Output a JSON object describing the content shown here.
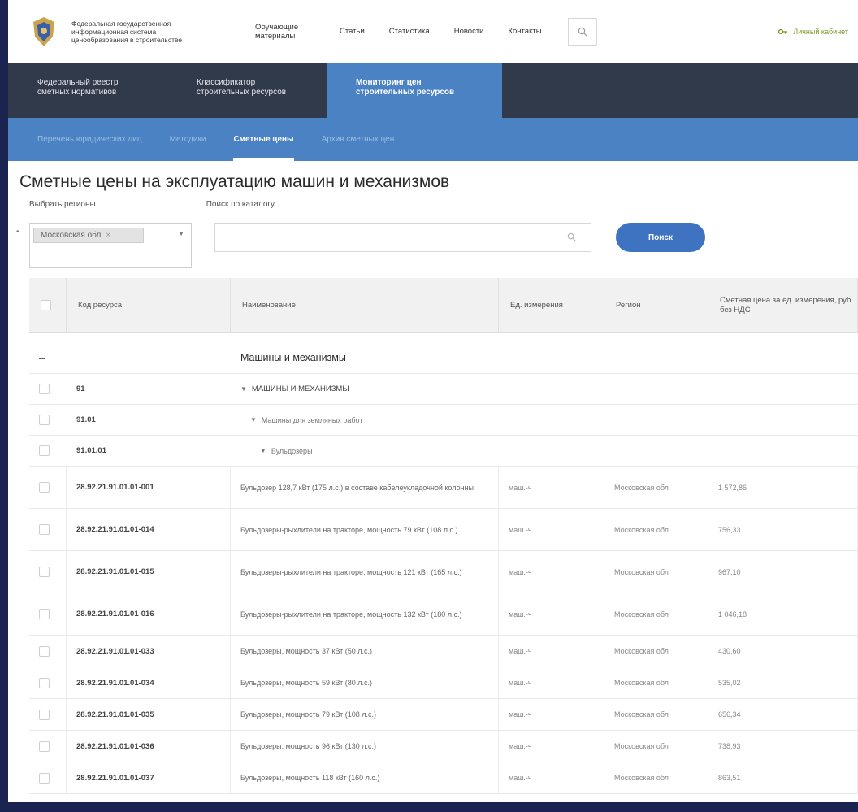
{
  "header": {
    "org_name_lines": [
      "Федеральная государственная",
      "информационная система",
      "ценообразования в строительстве"
    ],
    "nav": [
      {
        "label": "Обучающие материалы"
      },
      {
        "label": "Статьи"
      },
      {
        "label": "Статистика"
      },
      {
        "label": "Новости"
      },
      {
        "label": "Контакты"
      }
    ],
    "cabinet_label": "Личный кабинет"
  },
  "main_tabs": [
    {
      "line1": "Федеральный реестр",
      "line2": "сметных нормативов"
    },
    {
      "line1": "Классификатор",
      "line2": "строительных ресурсов"
    },
    {
      "line1": "Мониторинг цен",
      "line2": "строительных ресурсов"
    }
  ],
  "sub_tabs": [
    {
      "label": "Перечень юридических лиц"
    },
    {
      "label": "Методики"
    },
    {
      "label": "Сметные цены"
    },
    {
      "label": "Архив сметных цен"
    }
  ],
  "page": {
    "title": "Сметные цены на эксплуатацию машин и механизмов",
    "regions_label": "Выбрать регионы",
    "catalog_label": "Поиск по каталогу",
    "selected_region": "Московская обл",
    "search_value": "",
    "search_button": "Поиск"
  },
  "table": {
    "columns": [
      "Код ресурса",
      "Наименование",
      "Ед. измерения",
      "Регион",
      "Сметная цена за ед. измерения, руб. без НДС"
    ],
    "group_title": "Машины и механизмы",
    "levels": [
      {
        "code": "91",
        "name": "МАШИНЫ И МЕХАНИЗМЫ"
      },
      {
        "code": "91.01",
        "name": "Машины для земляных работ"
      },
      {
        "code": "91.01.01",
        "name": "Бульдозеры"
      }
    ],
    "rows": [
      {
        "code": "28.92.21.91.01.01-001",
        "name": "Бульдозер 128,7 кВт (175 л.с.) в составе кабелеукладочной колонны",
        "unit": "маш.-ч",
        "region": "Московская обл",
        "price": "1 572,86"
      },
      {
        "code": "28.92.21.91.01.01-014",
        "name": "Бульдозеры-рыхлители на тракторе, мощность 79 кВт (108 л.с.)",
        "unit": "маш.-ч",
        "region": "Московская обл",
        "price": "756,33"
      },
      {
        "code": "28.92.21.91.01.01-015",
        "name": "Бульдозеры-рыхлители на тракторе, мощность 121 кВт (165 л.с.)",
        "unit": "маш.-ч",
        "region": "Московская обл",
        "price": "967,10"
      },
      {
        "code": "28.92.21.91.01.01-016",
        "name": "Бульдозеры-рыхлители на тракторе, мощность 132 кВт (180 л.с.)",
        "unit": "маш.-ч",
        "region": "Московская обл",
        "price": "1 046,18"
      },
      {
        "code": "28.92.21.91.01.01-033",
        "name": "Бульдозеры, мощность 37 кВт (50 л.с.)",
        "unit": "маш.-ч",
        "region": "Московская обл",
        "price": "430,60"
      },
      {
        "code": "28.92.21.91.01.01-034",
        "name": "Бульдозеры, мощность 59 кВт (80 л.с.)",
        "unit": "маш.-ч",
        "region": "Московская обл",
        "price": "535,02"
      },
      {
        "code": "28.92.21.91.01.01-035",
        "name": "Бульдозеры, мощность 79 кВт (108 л.с.)",
        "unit": "маш.-ч",
        "region": "Московская обл",
        "price": "656,34"
      },
      {
        "code": "28.92.21.91.01.01-036",
        "name": "Бульдозеры, мощность 96 кВт (130 л.с.)",
        "unit": "маш.-ч",
        "region": "Московская обл",
        "price": "738,93"
      },
      {
        "code": "28.92.21.91.01.01-037",
        "name": "Бульдозеры, мощность 118 кВт (160 л.с.)",
        "unit": "маш.-ч",
        "region": "Московская обл",
        "price": "863,51"
      }
    ]
  },
  "colors": {
    "dark_tabs": "#313a4b",
    "accent_blue": "#4a82c3",
    "button_blue": "#3e73c2",
    "cabinet_green": "#7a9a2a"
  }
}
